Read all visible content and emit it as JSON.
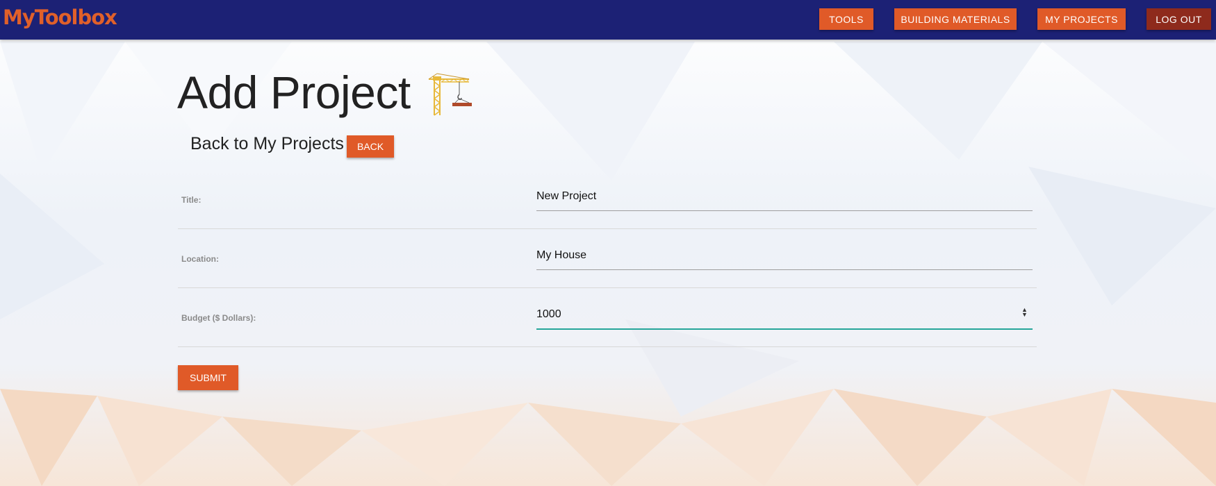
{
  "brand": "MyToolbox",
  "nav": {
    "tools": "TOOLS",
    "building_materials": "BUILDING MATERIALS",
    "my_projects": "MY PROJECTS",
    "log_out": "LOG OUT"
  },
  "page": {
    "title": "Add Project",
    "title_icon": "crane-icon",
    "back_label": "Back to My Projects",
    "back_button": "BACK"
  },
  "form": {
    "fields": [
      {
        "label": "Title:",
        "value": "New Project"
      },
      {
        "label": "Location:",
        "value": "My House"
      },
      {
        "label": "Budget ($ Dollars):",
        "value": "1000"
      }
    ],
    "submit": "SUBMIT"
  },
  "colors": {
    "navbar": "#1c2175",
    "accent": "#e05a28",
    "logout": "#8e2a1c",
    "brand": "#e0602a",
    "focus": "#26a69a"
  }
}
